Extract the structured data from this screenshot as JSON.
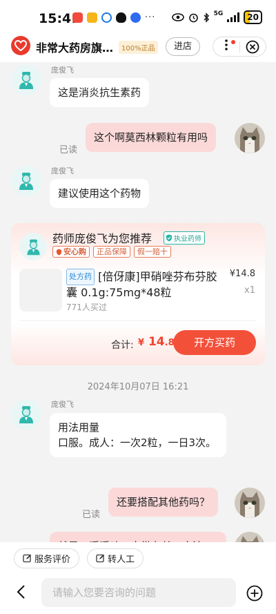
{
  "status_bar": {
    "time": "15:41",
    "network": "5G",
    "battery": "20",
    "more": "···"
  },
  "header": {
    "store_name": "非常大药房旗舰店",
    "genuine_badge": "100%正品",
    "enter_label": "进店"
  },
  "messages": [
    {
      "id": "m1",
      "side": "left",
      "sender": "庞俊飞",
      "text": "这是消炎抗生素药"
    },
    {
      "id": "m2",
      "side": "right",
      "text": "这个啊莫西林颗粒有用吗",
      "status": "已读"
    },
    {
      "id": "m3",
      "side": "left",
      "sender": "庞俊飞",
      "text": "建议使用这个药物"
    },
    {
      "id": "m5",
      "side": "left",
      "sender": "庞俊飞",
      "text": "用法用量\n口服。成人：一次2粒，一日3次。"
    },
    {
      "id": "m6",
      "side": "right",
      "text": "还要搭配其他药吗？",
      "status": "已读"
    },
    {
      "id": "m7",
      "side": "right",
      "text": "就是一暖暖吐口水带有丝口水溶",
      "partial": true
    }
  ],
  "recommend_card": {
    "title": "药师庞俊飞为您推荐",
    "pharmacist_badge": "执业药师",
    "tags": [
      "安心购",
      "正品保障",
      "假一赔十"
    ],
    "rx_tag": "处方药",
    "product_name": "[倍伢康]甲硝唑芬布芬胶囊 0.1g:75mg*48粒",
    "price": "¥14.8",
    "quantity": "x1",
    "sold": "771人买过",
    "total_label": "合计:",
    "total_currency": "¥",
    "total_int": "14",
    "total_dec": ".8",
    "buy_button": "开方买药"
  },
  "date_separator": "2024年10月07日 16:21",
  "quick_actions": [
    {
      "label": "服务评价",
      "icon": "edit-icon"
    },
    {
      "label": "转人工",
      "icon": "edit-icon"
    }
  ],
  "input": {
    "placeholder": "请输入您要咨询的问题"
  },
  "colors": {
    "accent": "#f3503a",
    "bubble_right": "#fcd9d9",
    "pharmacist_teal": "#27b5a4"
  }
}
